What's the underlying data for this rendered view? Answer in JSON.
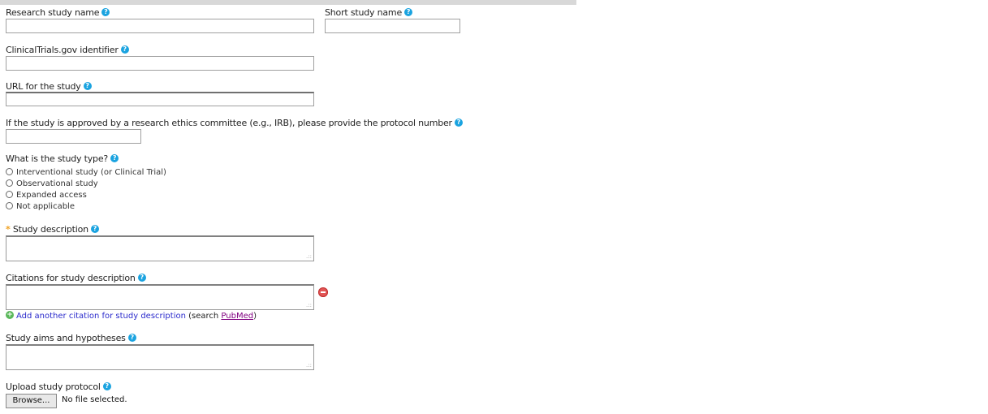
{
  "fields": {
    "research_name_label": "Research study name",
    "short_name_label": "Short study name",
    "clinicaltrials_label": "ClinicalTrials.gov identifier",
    "url_label": "URL for the study",
    "ethics_label": "If the study is approved by a research ethics committee (e.g., IRB), please provide the protocol number",
    "study_type_label": "What is the study type?",
    "description_label": "Study description",
    "citations_label": "Citations for study description",
    "aims_label": "Study aims and hypotheses",
    "protocol_label": "Upload study protocol"
  },
  "required_mark": "*",
  "help_glyph": "?",
  "study_type_options": [
    "Interventional study (or Clinical Trial)",
    "Observational study",
    "Expanded access",
    "Not applicable"
  ],
  "add_citation": {
    "icon_glyph": "+",
    "link_text": "Add another citation for study description",
    "search_prefix": " (search ",
    "pubmed_link": "PubMed",
    "search_suffix": ")"
  },
  "upload": {
    "browse_label": "Browse...",
    "no_file_text": "No file selected."
  },
  "grip_glyph": ".::",
  "colors": {
    "help_icon": "#1aa3e0",
    "required": "#f0a020",
    "remove_icon": "#e25555",
    "add_icon": "#5bb85b",
    "link": "#2a2acc",
    "visited_link": "#800080"
  },
  "icons": {
    "help": "help-icon",
    "remove": "remove-icon",
    "add": "add-icon"
  }
}
